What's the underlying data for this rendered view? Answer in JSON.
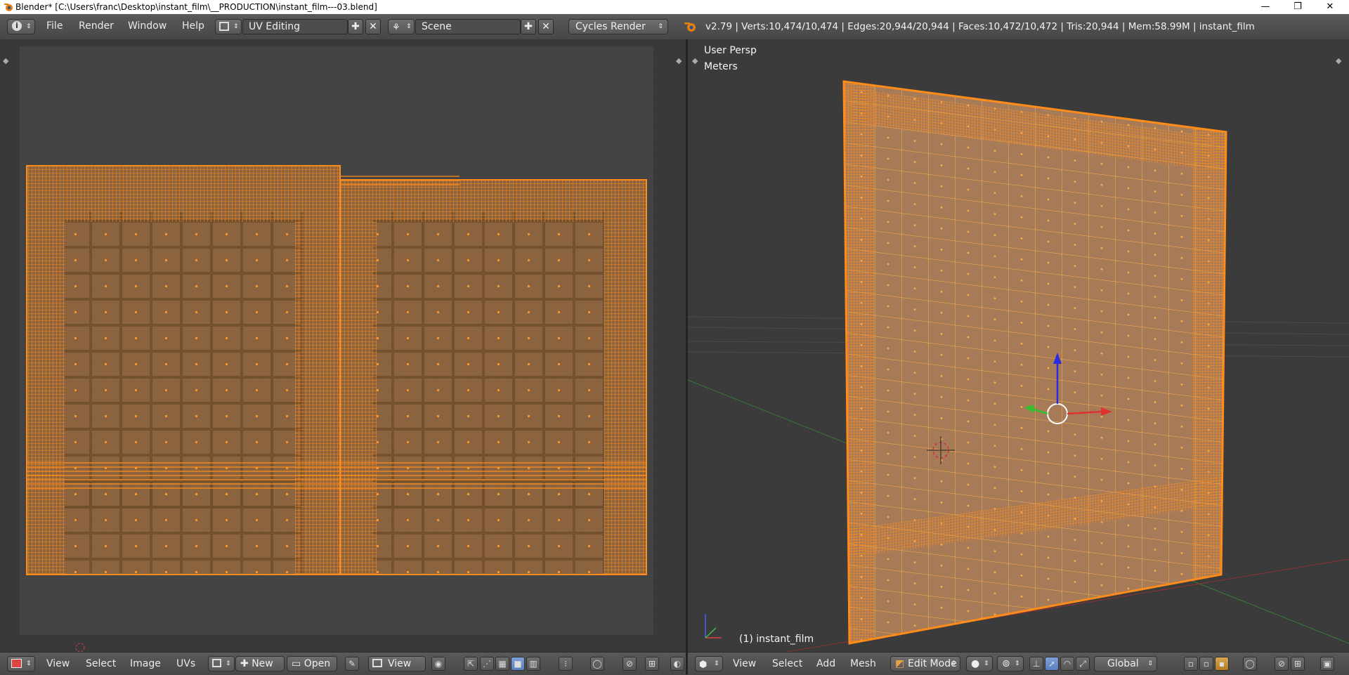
{
  "window": {
    "title": "Blender* [C:\\Users\\franc\\Desktop\\instant_film\\__PRODUCTION\\instant_film---03.blend]",
    "minimize": "—",
    "maximize": "❐",
    "close": "✕"
  },
  "header": {
    "menus": [
      "File",
      "Render",
      "Window",
      "Help"
    ],
    "screen_layout": "UV Editing",
    "scene": "Scene",
    "render_engine": "Cycles Render",
    "stats": "v2.79 | Verts:10,474/10,474 | Edges:20,944/20,944 | Faces:10,472/10,472 | Tris:20,944 | Mem:58.99M | instant_film"
  },
  "viewport": {
    "view_name": "User Persp",
    "units": "Meters",
    "object_label": "(1) instant_film"
  },
  "uv_footer": {
    "menus": [
      "View",
      "Select",
      "Image",
      "UVs"
    ],
    "new_label": "New",
    "open_label": "Open",
    "view_label": "View"
  },
  "view3d_footer": {
    "menus": [
      "View",
      "Select",
      "Add",
      "Mesh"
    ],
    "mode": "Edit Mode",
    "orientation": "Global"
  },
  "colors": {
    "selection_orange": "#ff8c1a",
    "face_fill": "#a77b58",
    "grid_bg": "#393939",
    "active_button": "#5a7fbf"
  },
  "icons": [
    "blender-logo-icon",
    "info-icon",
    "screen-layout-icon",
    "scene-icon",
    "add-icon",
    "close-icon",
    "editor-type-icon",
    "image-icon",
    "pin-icon",
    "sync-icon",
    "snap-icon",
    "shading-icon",
    "manipulator-icon",
    "proportional-icon",
    "axis-icon"
  ]
}
